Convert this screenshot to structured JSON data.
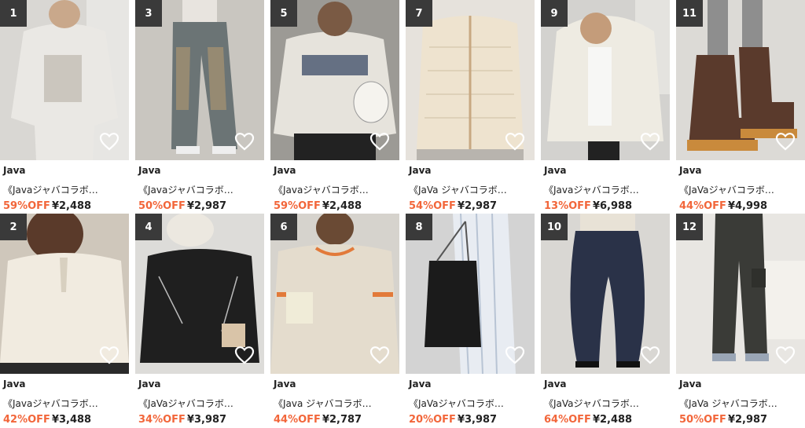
{
  "colors": {
    "discount": "#f2663a",
    "rank_badge": "#3a3a3a",
    "text": "#222222"
  },
  "products": [
    {
      "rank": "1",
      "brand": "Java",
      "name": "《Javaジャバコラボ…",
      "discount": "59%OFF",
      "price": "¥2,488",
      "icon": "heart-icon",
      "bg": "#d9d7d3",
      "fg": "#eae8e4"
    },
    {
      "rank": "3",
      "brand": "Java",
      "name": "《Javaジャバコラボ…",
      "discount": "50%OFF",
      "price": "¥2,987",
      "icon": "heart-icon",
      "bg": "#c9c6c0",
      "fg": "#6b7475"
    },
    {
      "rank": "5",
      "brand": "Java",
      "name": "《Javaジャバコラボ…",
      "discount": "59%OFF",
      "price": "¥2,488",
      "icon": "heart-icon",
      "bg": "#9c9a95",
      "fg": "#e6e3dc"
    },
    {
      "rank": "7",
      "brand": "Java",
      "name": "《JaVa ジャバコラボ…",
      "discount": "54%OFF",
      "price": "¥2,987",
      "icon": "heart-icon",
      "bg": "#e6e2dc",
      "fg": "#eee3cf"
    },
    {
      "rank": "9",
      "brand": "Java",
      "name": "《Javaジャバコラボ…",
      "discount": "13%OFF",
      "price": "¥6,988",
      "icon": "heart-icon",
      "bg": "#d3d2cf",
      "fg": "#eeebe2"
    },
    {
      "rank": "11",
      "brand": "Java",
      "name": "《JaVaジャバコラボ…",
      "discount": "44%OFF",
      "price": "¥4,998",
      "icon": "heart-icon",
      "bg": "#dcdad6",
      "fg": "#5a3a2c"
    },
    {
      "rank": "2",
      "brand": "Java",
      "name": "《Javaジャバコラボ…",
      "discount": "42%OFF",
      "price": "¥3,488",
      "icon": "heart-icon",
      "bg": "#cfc7bb",
      "fg": "#f1ebe0"
    },
    {
      "rank": "4",
      "brand": "Java",
      "name": "《JaVaジャバコラボ…",
      "discount": "34%OFF",
      "price": "¥3,987",
      "icon": "heart-icon",
      "bg": "#dddcd9",
      "fg": "#1f1f1f"
    },
    {
      "rank": "6",
      "brand": "Java",
      "name": "《Java ジャバコラボ…",
      "discount": "44%OFF",
      "price": "¥2,787",
      "icon": "heart-icon",
      "bg": "#d6d3cd",
      "fg": "#e4dccd"
    },
    {
      "rank": "8",
      "brand": "Java",
      "name": "《JaVaジャバコラボ…",
      "discount": "20%OFF",
      "price": "¥3,987",
      "icon": "heart-icon",
      "bg": "#d3d3d3",
      "fg": "#1b1b1b"
    },
    {
      "rank": "10",
      "brand": "Java",
      "name": "《JaVaジャバコラボ…",
      "discount": "64%OFF",
      "price": "¥2,488",
      "icon": "heart-icon",
      "bg": "#d9d7d3",
      "fg": "#2a3248"
    },
    {
      "rank": "12",
      "brand": "Java",
      "name": "《JaVa ジャバコラボ…",
      "discount": "50%OFF",
      "price": "¥2,987",
      "icon": "heart-icon",
      "bg": "#e8e6e2",
      "fg": "#3a3b37"
    }
  ]
}
